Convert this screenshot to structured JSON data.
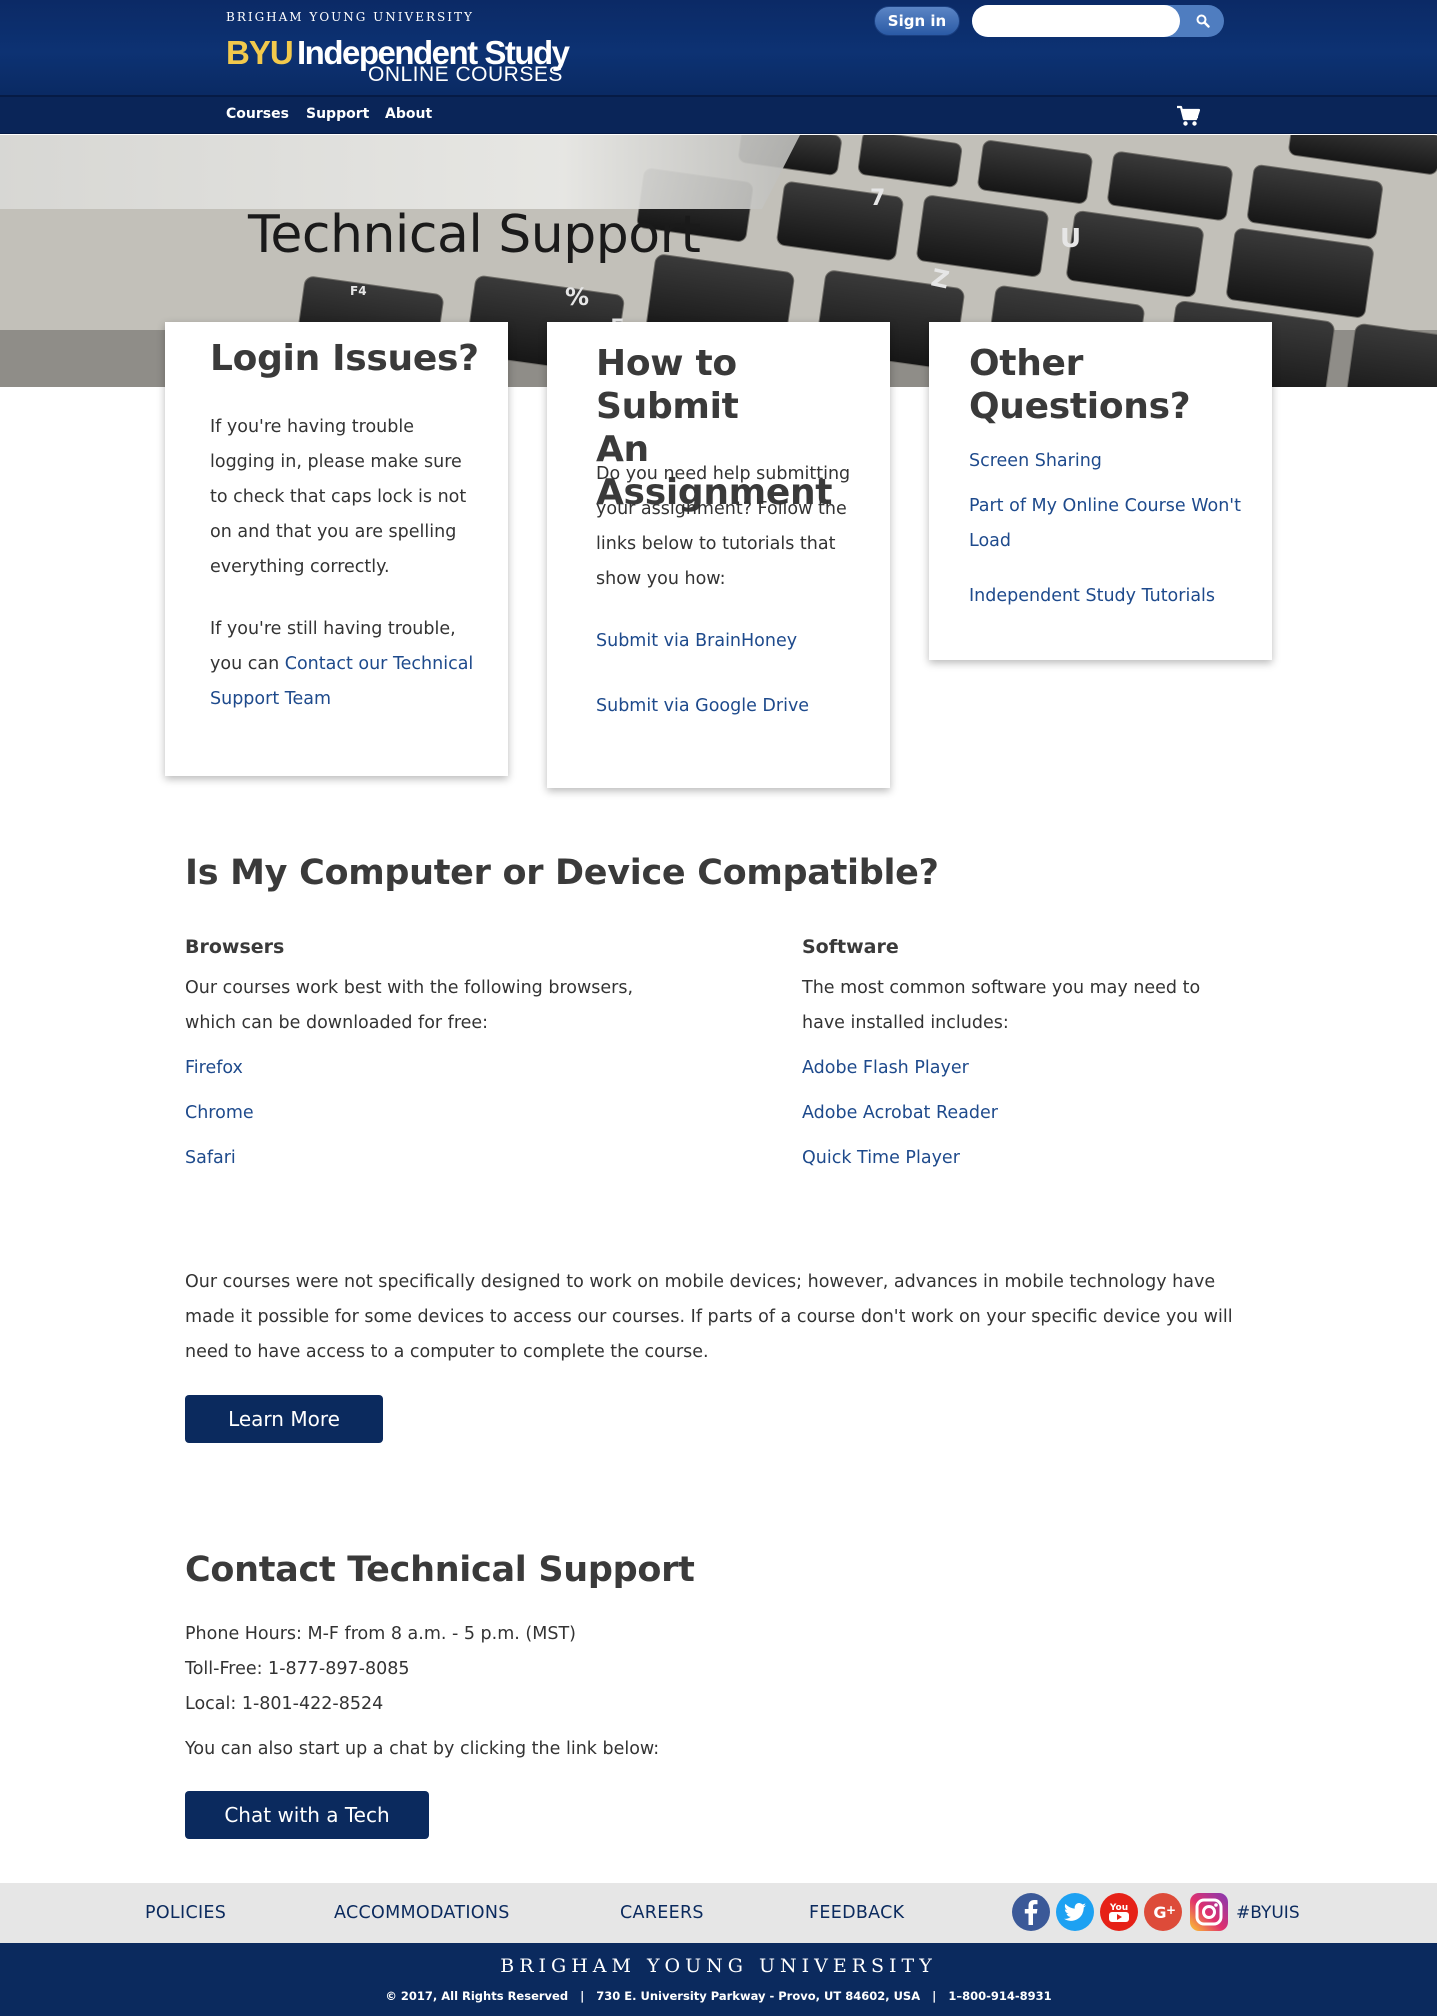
{
  "header": {
    "university": "BRIGHAM YOUNG UNIVERSITY",
    "logo_byu": "BYU",
    "logo_name": "Independent Study",
    "logo_sub": "ONLINE COURSES",
    "signin_label": "Sign in",
    "search_placeholder": "",
    "search_icon": "search-icon",
    "cart_icon": "shopping-cart-icon"
  },
  "nav": {
    "items": [
      "Courses",
      "Support",
      "About"
    ]
  },
  "hero": {
    "title": "Technical Support"
  },
  "cards": {
    "login": {
      "title": "Login Issues?",
      "text1": "If you're having trouble logging in, please make sure to check that caps lock is not on and that you are spelling everything correctly.",
      "text2_prefix": "If you're still having trouble, you can",
      "text2_link": "Contact our Technical Support Team"
    },
    "submit": {
      "title_line1": "How to Submit",
      "title_line2": "An Assignment",
      "text": "Do you need help submitting your assignment? Follow the links below to tutorials that show you how:",
      "link1": "Submit via BrainHoney",
      "link2": "Submit via Google Drive"
    },
    "other": {
      "title_line1": "Other",
      "title_line2": "Questions?",
      "link1": "Screen Sharing",
      "link2": "Part of My Online Course Won't Load",
      "link3": "Independent Study Tutorials"
    }
  },
  "compat": {
    "title": "Is My Computer or Device Compatible?",
    "browsers": {
      "heading": "Browsers",
      "text": "Our courses work best with the following browsers, which can be downloaded for free:",
      "links": [
        "Firefox",
        "Chrome",
        "Safari"
      ]
    },
    "software": {
      "heading": "Software",
      "text": "The most common software you may need to have installed includes:",
      "links": [
        "Adobe Flash Player",
        "Adobe Acrobat Reader",
        "Quick Time Player"
      ]
    },
    "mobile_text": "Our courses were not specifically designed to work on mobile devices; however, advances in mobile technology have made it possible for some devices to access our courses. If parts of a course don't work on your specific device you will need to have access to a computer to complete the course.",
    "learn_more": "Learn More"
  },
  "contact": {
    "title": "Contact Technical Support",
    "hours": "Phone Hours: M-F from 8 a.m. - 5 p.m. (MST)",
    "tollfree": "Toll-Free: 1-877-897-8085",
    "local": "Local: 1-801-422-8524",
    "chat_text": "You can also start up a chat by clicking the link below:",
    "chat_button": "Chat with a Tech"
  },
  "footer": {
    "links": [
      "POLICIES",
      "ACCOMMODATIONS",
      "CAREERS",
      "FEEDBACK"
    ],
    "social": [
      "facebook-icon",
      "twitter-icon",
      "youtube-icon",
      "google-plus-icon",
      "instagram-icon"
    ],
    "hashtag": "#BYUIS",
    "university": "BRIGHAM YOUNG UNIVERSITY",
    "info": "© 2017, All Rights Reserved   |   730 E. University Parkway - Provo, UT 84602, USA   |   1–800-914-8931"
  },
  "colors": {
    "navy": "#0b2a5e",
    "link": "#1e4a8c",
    "gold": "#f2c94c"
  }
}
